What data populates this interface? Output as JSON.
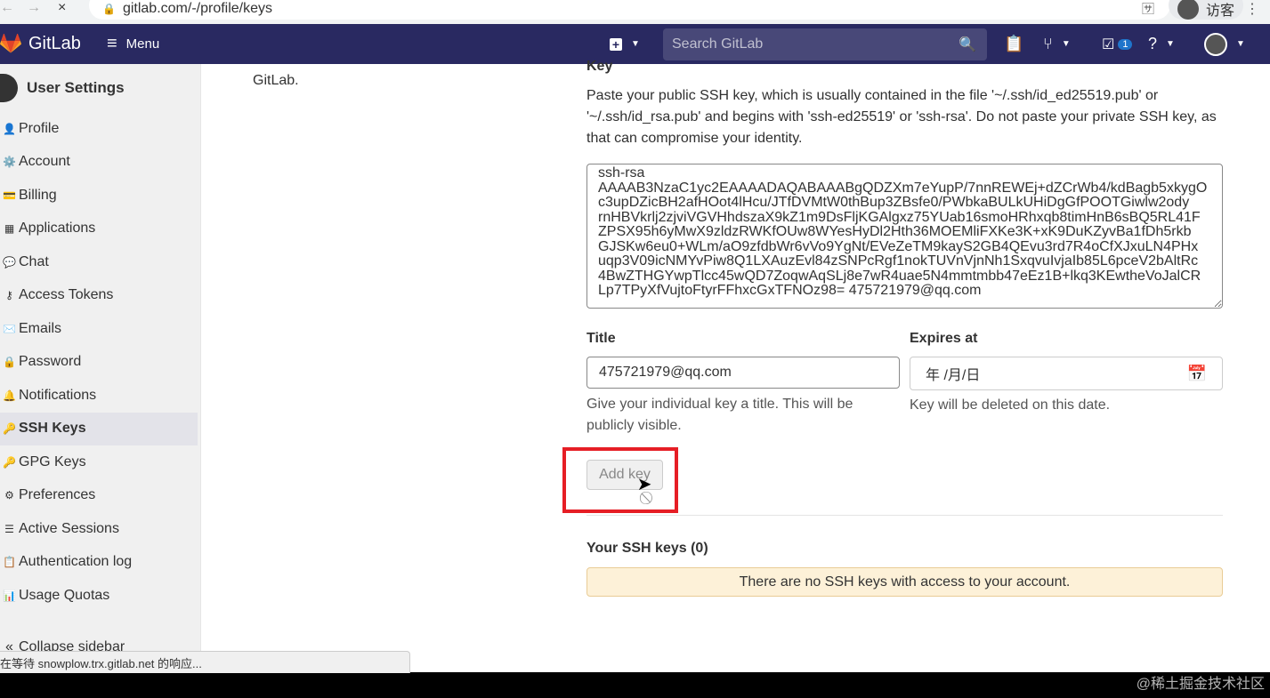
{
  "browser": {
    "url": "gitlab.com/-/profile/keys",
    "user": "访客",
    "status": "在等待 snowplow.trx.gitlab.net 的响应..."
  },
  "header": {
    "brand": "GitLab",
    "menu": "Menu",
    "search_placeholder": "Search GitLab",
    "todo_count": "1"
  },
  "sidebar": {
    "title": "User Settings",
    "items": [
      {
        "label": "Profile",
        "icon": "profile-icon"
      },
      {
        "label": "Account",
        "icon": "account-icon"
      },
      {
        "label": "Billing",
        "icon": "billing-icon"
      },
      {
        "label": "Applications",
        "icon": "applications-icon"
      },
      {
        "label": "Chat",
        "icon": "chat-icon"
      },
      {
        "label": "Access Tokens",
        "icon": "access-tokens-icon"
      },
      {
        "label": "Emails",
        "icon": "emails-icon"
      },
      {
        "label": "Password",
        "icon": "password-icon"
      },
      {
        "label": "Notifications",
        "icon": "notifications-icon"
      },
      {
        "label": "SSH Keys",
        "icon": "ssh-keys-icon",
        "active": true
      },
      {
        "label": "GPG Keys",
        "icon": "gpg-keys-icon"
      },
      {
        "label": "Preferences",
        "icon": "preferences-icon"
      },
      {
        "label": "Active Sessions",
        "icon": "active-sessions-icon"
      },
      {
        "label": "Authentication log",
        "icon": "auth-log-icon"
      },
      {
        "label": "Usage Quotas",
        "icon": "usage-quotas-icon"
      }
    ],
    "collapse_label": "Collapse sidebar"
  },
  "content": {
    "left_text": "GitLab.",
    "key_label": "Key",
    "key_desc": "Paste your public SSH key, which is usually contained in the file '~/.ssh/id_ed25519.pub' or '~/.ssh/id_rsa.pub' and begins with 'ssh-ed25519' or 'ssh-rsa'. Do not paste your private SSH key, as that can compromise your identity.",
    "key_value": "ssh-rsa\nAAAAB3NzaC1yc2EAAAADAQABAAABgQDZXm7eYupP/7nnREWEj+dZCrWb4/kdBagb5xkygO\nc3upDZicBH2afHOot4lHcu/JTfDVMtW0thBup3ZBsfe0/PWbkaBULkUHiDgGfPOOTGiwlw2ody\nrnHBVkrlj2zjviVGVHhdszaX9kZ1m9DsFljKGAlgxz75YUab16smoHRhxqb8timHnB6sBQ5RL41F\nZPSX95h6yMwX9zldzRWKfOUw8WYesHyDl2Hth36MOEMliFXKe3K+xK9DuKZyvBa1fDh5rkb\nGJSKw6eu0+WLm/aO9zfdbWr6vVo9YgNt/EVeZeTM9kayS2GB4QEvu3rd7R4oCfXJxuLN4PHx\nuqp3V09icNMYvPiw8Q1LXAuzEvl84zSNPcRgf1nokTUVnVjnNh1SxqvuIvjaIb85L6pceV2bAltRc\n4BwZTHGYwpTlcc45wQD7ZoqwAqSLj8e7wR4uae5N4mmtmbb47eEz1B+lkq3KEwtheVoJalCR\nLp7TPyXfVujtoFtyrFFhxcGxTFNOz98= 475721979@qq.com",
    "title_label": "Title",
    "title_value": "475721979@qq.com",
    "title_desc": "Give your individual key a title. This will be publicly visible.",
    "expires_label": "Expires at",
    "expires_value": "年 /月/日",
    "expires_desc": "Key will be deleted on this date.",
    "add_key_btn": "Add key",
    "your_keys_title": "Your SSH keys (0)",
    "no_keys_msg": "There are no SSH keys with access to your account.",
    "watermark": "@稀土掘金技术社区"
  }
}
